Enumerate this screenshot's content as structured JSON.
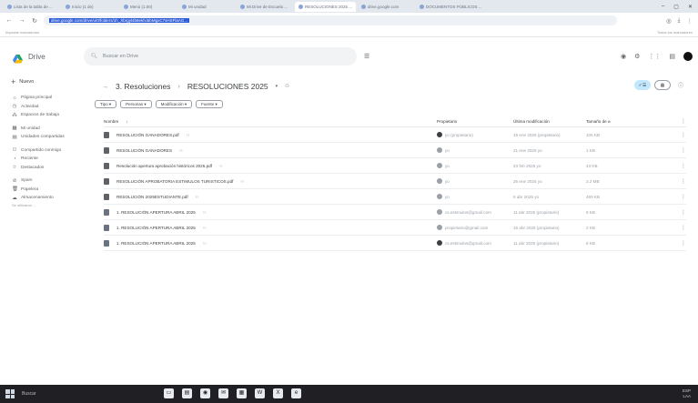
{
  "browser": {
    "tabs": [
      {
        "label": "Lista de la tabla de ..."
      },
      {
        "label": "Inicio (1 de)",
        "active": false
      },
      {
        "label": "Menú (1.00)"
      },
      {
        "label": "Mi unidad"
      },
      {
        "label": "Mi Drive de Escuela ..."
      },
      {
        "label": "RESOLUCIONES 2025 ..."
      },
      {
        "label": "drive.google.com"
      },
      {
        "label": "DOCUMENTOS PÚBLICOS ..."
      }
    ],
    "url_text": "drive.google.com/drive/u/0/folders/1h_Xbrgyl4b8ekfxi5bMgxC7sHSFlaAG...",
    "bookmarks_left": "Importar marcadores",
    "bookmarks_right": "Todos los marcadores"
  },
  "drive": {
    "app_name": "Drive",
    "search_placeholder": "Buscar en Drive",
    "sidebar": {
      "new_label": "Nuevo",
      "groups": [
        [
          {
            "icon": "home-icon",
            "glyph": "⌂",
            "label": "Página principal"
          },
          {
            "icon": "activity-icon",
            "glyph": "◷",
            "label": "Actividad"
          },
          {
            "icon": "workspaces-icon",
            "glyph": "⁂",
            "label": "Espacios de trabajo"
          }
        ],
        [
          {
            "icon": "my-drive-icon",
            "glyph": "▦",
            "label": "Mi unidad"
          },
          {
            "icon": "shared-drives-icon",
            "glyph": "▤",
            "label": "Unidades compartidas"
          }
        ],
        [
          {
            "icon": "shared-with-me-icon",
            "glyph": "⚇",
            "label": "Compartido conmigo"
          },
          {
            "icon": "recent-icon",
            "glyph": "◔",
            "label": "Reciente"
          },
          {
            "icon": "starred-icon",
            "glyph": "☆",
            "label": "Destacados"
          }
        ],
        [
          {
            "icon": "spam-icon",
            "glyph": "⊘",
            "label": "Spam"
          },
          {
            "icon": "trash-icon",
            "glyph": "🗑",
            "label": "Papelera"
          },
          {
            "icon": "storage-icon",
            "glyph": "☁",
            "label": "Almacenamiento"
          }
        ]
      ],
      "storage_text": "Se utilizaron ..."
    },
    "breadcrumb": {
      "parent": "3. Resoluciones",
      "current": "RESOLUCIONES 2025"
    },
    "filters": [
      "Tipo",
      "Personas",
      "Modificación",
      "Fuente"
    ],
    "table": {
      "headers": {
        "name": "Nombre",
        "owner": "Propietario",
        "modified": "Última modificación",
        "size": "Tamaño de a"
      },
      "rows": [
        {
          "name": "RESOLUCIÓN GANADORES.pdf",
          "owner": "yo (propietario)",
          "owner_dark": true,
          "modified": "19 ene 2025 (propietario)",
          "size": "105 KB",
          "icon": "pdf"
        },
        {
          "name": "RESOLUCIÓN GANADORES",
          "owner": "yo",
          "owner_dark": false,
          "modified": "21 ene 2025 yo",
          "size": "1 KB",
          "icon": "doc"
        },
        {
          "name": "Resolución apertura aprobación históricos 2025.pdf",
          "owner": "yo",
          "owner_dark": false,
          "modified": "23 feb 2025 yo",
          "size": "43 KB",
          "icon": "pdf"
        },
        {
          "name": "RESOLUCIÓN APROBATORIA ESTIMULOS TURISTICOS.pdf",
          "owner": "yo",
          "owner_dark": false,
          "modified": "26 ene 2025 yo",
          "size": "2.2 MB",
          "icon": "pdf"
        },
        {
          "name": "RESOLUCIÓN 2025ESTUDIANTE.pdf",
          "owner": "yo",
          "owner_dark": false,
          "modified": "6 abr 2025 yo",
          "size": "469 KB",
          "icon": "pdf"
        },
        {
          "name": "1. RESOLUCIÓN APERTURA ABRIL 2025",
          "owner": "cs.estimulos@gmail.com",
          "owner_dark": false,
          "modified": "11 abr 2025 (propietario)",
          "size": "8 KB",
          "icon": "img"
        },
        {
          "name": "1. RESOLUCIÓN APERTURA ABRIL 2025",
          "owner": "propietario@gmail.com",
          "owner_dark": false,
          "modified": "16 abr 2025 (propietario)",
          "size": "2 KB",
          "icon": "img"
        },
        {
          "name": "1. RESOLUCIÓN APERTURA ABRIL 2025",
          "owner": "cs.estimulos@gmail.com",
          "owner_dark": true,
          "modified": "11 abr 2025 (propietario)",
          "size": "8 KB",
          "icon": "img"
        }
      ]
    }
  },
  "taskbar": {
    "search_label": "Buscar",
    "tray_line1": "ESP",
    "tray_line2": "LAA"
  },
  "colors": {
    "accent": "#c2e7ff",
    "taskbar": "#1f1f24"
  }
}
